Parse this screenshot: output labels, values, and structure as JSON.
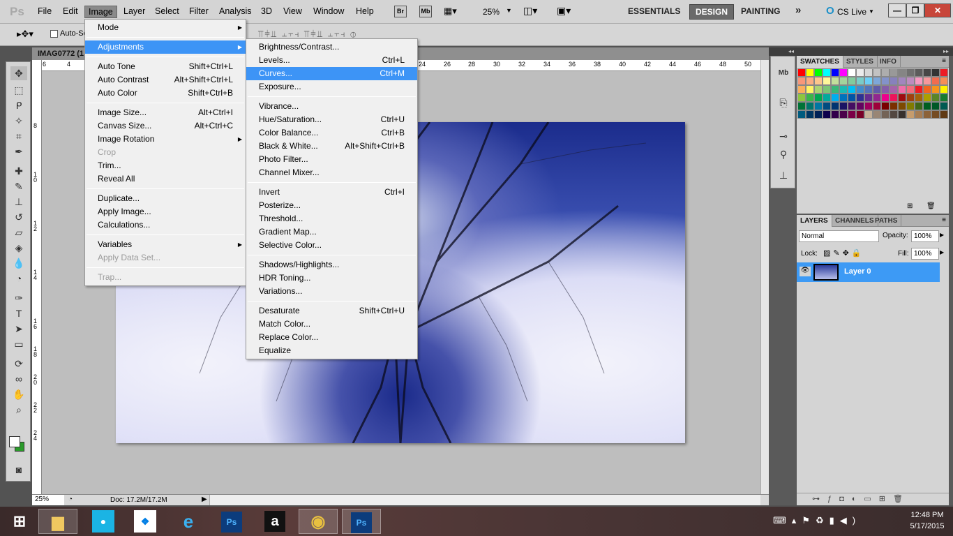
{
  "app": {
    "logo": "Ps"
  },
  "menubar": [
    "File",
    "Edit",
    "Image",
    "Layer",
    "Select",
    "Filter",
    "Analysis",
    "3D",
    "View",
    "Window",
    "Help"
  ],
  "topbar": {
    "bridge": "Br",
    "minibridge": "Mb",
    "zoom": "25%",
    "workspaces": [
      "ESSENTIALS",
      "DESIGN",
      "PAINTING"
    ],
    "selected_workspace": "DESIGN",
    "more": "»",
    "cslive": "CS Live"
  },
  "options": {
    "auto_select": "Auto-Se"
  },
  "document": {
    "tab_title": "IMAG0772 (1",
    "zoom": "25%",
    "doc_info": "Doc: 17.2M/17.2M"
  },
  "ruler_top": [
    "6",
    "4",
    "24",
    "26",
    "28",
    "30",
    "32",
    "34",
    "36",
    "38",
    "40",
    "42",
    "44",
    "46",
    "48",
    "50"
  ],
  "ruler_left": [
    "8",
    "1 0",
    "1 2",
    "1 4",
    "1 6",
    "1 8",
    "2 0",
    "2 2",
    "2 4"
  ],
  "image_menu": [
    {
      "label": "Mode",
      "submenu": true
    },
    {
      "sep": true
    },
    {
      "label": "Adjustments",
      "submenu": true,
      "highlighted": true
    },
    {
      "sep": true
    },
    {
      "label": "Auto Tone",
      "shortcut": "Shift+Ctrl+L"
    },
    {
      "label": "Auto Contrast",
      "shortcut": "Alt+Shift+Ctrl+L"
    },
    {
      "label": "Auto Color",
      "shortcut": "Shift+Ctrl+B"
    },
    {
      "sep": true
    },
    {
      "label": "Image Size...",
      "shortcut": "Alt+Ctrl+I"
    },
    {
      "label": "Canvas Size...",
      "shortcut": "Alt+Ctrl+C"
    },
    {
      "label": "Image Rotation",
      "submenu": true
    },
    {
      "label": "Crop",
      "disabled": true
    },
    {
      "label": "Trim..."
    },
    {
      "label": "Reveal All"
    },
    {
      "sep": true
    },
    {
      "label": "Duplicate..."
    },
    {
      "label": "Apply Image..."
    },
    {
      "label": "Calculations..."
    },
    {
      "sep": true
    },
    {
      "label": "Variables",
      "submenu": true
    },
    {
      "label": "Apply Data Set...",
      "disabled": true
    },
    {
      "sep": true
    },
    {
      "label": "Trap...",
      "disabled": true
    }
  ],
  "adjustments_menu": [
    {
      "label": "Brightness/Contrast..."
    },
    {
      "label": "Levels...",
      "shortcut": "Ctrl+L"
    },
    {
      "label": "Curves...",
      "shortcut": "Ctrl+M",
      "highlighted": true
    },
    {
      "label": "Exposure..."
    },
    {
      "sep": true
    },
    {
      "label": "Vibrance..."
    },
    {
      "label": "Hue/Saturation...",
      "shortcut": "Ctrl+U"
    },
    {
      "label": "Color Balance...",
      "shortcut": "Ctrl+B"
    },
    {
      "label": "Black & White...",
      "shortcut": "Alt+Shift+Ctrl+B"
    },
    {
      "label": "Photo Filter..."
    },
    {
      "label": "Channel Mixer..."
    },
    {
      "sep": true
    },
    {
      "label": "Invert",
      "shortcut": "Ctrl+I"
    },
    {
      "label": "Posterize..."
    },
    {
      "label": "Threshold..."
    },
    {
      "label": "Gradient Map..."
    },
    {
      "label": "Selective Color..."
    },
    {
      "sep": true
    },
    {
      "label": "Shadows/Highlights..."
    },
    {
      "label": "HDR Toning..."
    },
    {
      "label": "Variations..."
    },
    {
      "sep": true
    },
    {
      "label": "Desaturate",
      "shortcut": "Shift+Ctrl+U"
    },
    {
      "label": "Match Color..."
    },
    {
      "label": "Replace Color..."
    },
    {
      "label": "Equalize"
    }
  ],
  "swatches_panel": {
    "tabs": [
      "SWATCHES",
      "STYLES",
      "INFO"
    ],
    "colors": [
      "#ff0000",
      "#ffff00",
      "#00ff00",
      "#00ffff",
      "#0000ff",
      "#ff00ff",
      "#ffffff",
      "#ebebeb",
      "#d6d6d6",
      "#c2c2c2",
      "#adadad",
      "#999999",
      "#858585",
      "#707070",
      "#5c5c5c",
      "#474747",
      "#333333",
      "#ed1c24",
      "#f7977a",
      "#fbad82",
      "#fdc68c",
      "#fff79a",
      "#c4df9b",
      "#a3d39c",
      "#82ca9c",
      "#7accc8",
      "#6dcff6",
      "#7da7d9",
      "#8393ca",
      "#8781bd",
      "#a186be",
      "#bd8cbf",
      "#f49ac1",
      "#f5989d",
      "#f26c4f",
      "#f68e56",
      "#fbaf5c",
      "#fff467",
      "#acd372",
      "#7cc576",
      "#3bb878",
      "#1abbb4",
      "#00bff3",
      "#438ccb",
      "#5574b9",
      "#605ca8",
      "#855fa8",
      "#a763a9",
      "#f06ea9",
      "#f26d7d",
      "#ed1c24",
      "#f26522",
      "#f7941d",
      "#fff200",
      "#8dc63f",
      "#39b54a",
      "#00a651",
      "#00a99d",
      "#00aeef",
      "#0072bc",
      "#0054a6",
      "#2e3192",
      "#662d91",
      "#92278f",
      "#ec008c",
      "#ed145b",
      "#9e0b0f",
      "#a0410d",
      "#a3620a",
      "#aba000",
      "#598527",
      "#197b30",
      "#007236",
      "#00746b",
      "#0076a3",
      "#004b80",
      "#003471",
      "#1b1464",
      "#440e62",
      "#630460",
      "#9e005d",
      "#9e0039",
      "#790000",
      "#7b2e00",
      "#7d4900",
      "#827b00",
      "#406618",
      "#005e20",
      "#005826",
      "#005952",
      "#005b7f",
      "#003663",
      "#002157",
      "#0d004c",
      "#32004b",
      "#4b0049",
      "#7b0046",
      "#7a0026",
      "#c7b299",
      "#998675",
      "#736357",
      "#534741",
      "#37302d",
      "#c69c6d",
      "#a67c52",
      "#8c6239",
      "#754c24",
      "#603913"
    ]
  },
  "layers_panel": {
    "tabs": [
      "LAYERS",
      "CHANNELS",
      "PATHS"
    ],
    "blend_mode": "Normal",
    "opacity_label": "Opacity:",
    "opacity": "100%",
    "lock_label": "Lock:",
    "fill_label": "Fill:",
    "fill": "100%",
    "layers": [
      {
        "name": "Layer 0",
        "visible": true,
        "selected": true
      }
    ]
  },
  "tray": {
    "time": "12:48 PM",
    "date": "5/17/2015"
  },
  "taskbar": [
    "file-explorer",
    "media-app",
    "dropbox",
    "internet-explorer",
    "photoshop",
    "amazon",
    "chrome",
    "photoshop-active"
  ]
}
